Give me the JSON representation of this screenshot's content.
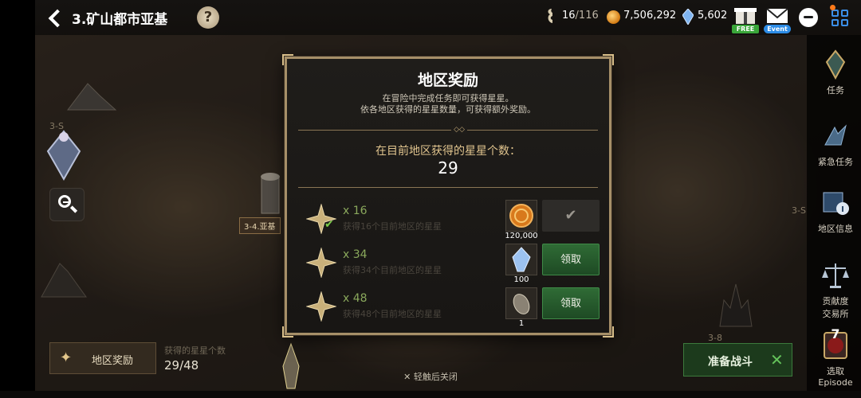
{
  "header": {
    "title": "3.矿山都市亚基",
    "help": "?",
    "stamina": {
      "current": "16",
      "max": "/116"
    },
    "gold": "7,506,292",
    "gems": "5,602",
    "free_badge": "FREE",
    "event_badge": "Event",
    "accent_color": "#3b8fe8"
  },
  "sidebar": {
    "items": [
      {
        "label": "任务",
        "icon": "quest-icon"
      },
      {
        "label": "紧急任务",
        "icon": "urgent-quest-icon"
      },
      {
        "label": "地区信息",
        "icon": "region-info-icon"
      },
      {
        "label": "贡献度\n交易所",
        "icon": "scales-icon"
      },
      {
        "label": "选取\nEpisode",
        "icon": "episode-icon",
        "number": "7"
      }
    ]
  },
  "map": {
    "stage_tag": "3-4.亚基",
    "labels": [
      "3-S",
      "3-S",
      "3-8"
    ]
  },
  "bottom": {
    "region_reward_label": "地区奖励",
    "obtained_label": "获得的星星个数",
    "obtained_count": "29/48",
    "battle_label": "准备战斗",
    "close_hint": "✕ 轻触后关闭"
  },
  "modal": {
    "title": "地区奖励",
    "desc_line1": "在冒险中完成任务即可获得星星。",
    "desc_line2": "依各地区获得的星星数量，可获得额外奖励。",
    "star_count_label": "在目前地区获得的星星个数：",
    "star_count": "29",
    "rewards": [
      {
        "count": "x 16",
        "desc": "获得16个目前地区的星星",
        "item": "gold-coin-icon",
        "qty": "120,000",
        "button": "✔",
        "claimed": true
      },
      {
        "count": "x 34",
        "desc": "获得34个目前地区的星星",
        "item": "crystal-icon",
        "qty": "100",
        "button": "领取",
        "claimed": false
      },
      {
        "count": "x 48",
        "desc": "获得48个目前地区的星星",
        "item": "seed-icon",
        "qty": "1",
        "button": "领取",
        "claimed": false
      }
    ]
  }
}
